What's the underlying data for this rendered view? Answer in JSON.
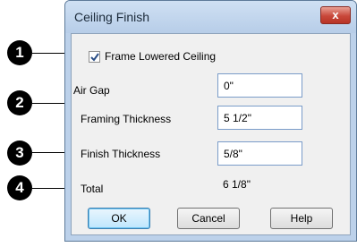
{
  "dialog": {
    "title": "Ceiling Finish",
    "close_glyph": "x"
  },
  "fields": {
    "frame_lowered_ceiling": {
      "label": "Frame Lowered Ceiling",
      "checked": true
    },
    "air_gap": {
      "label": "Air Gap",
      "value": "0\""
    },
    "framing_thickness": {
      "label": "Framing Thickness",
      "value": "5 1/2\""
    },
    "finish_thickness": {
      "label": "Finish Thickness",
      "value": "5/8\""
    },
    "total": {
      "label": "Total",
      "value": "6 1/8\""
    }
  },
  "buttons": {
    "ok": "OK",
    "cancel": "Cancel",
    "help": "Help"
  },
  "callouts": [
    "1",
    "2",
    "3",
    "4"
  ]
}
